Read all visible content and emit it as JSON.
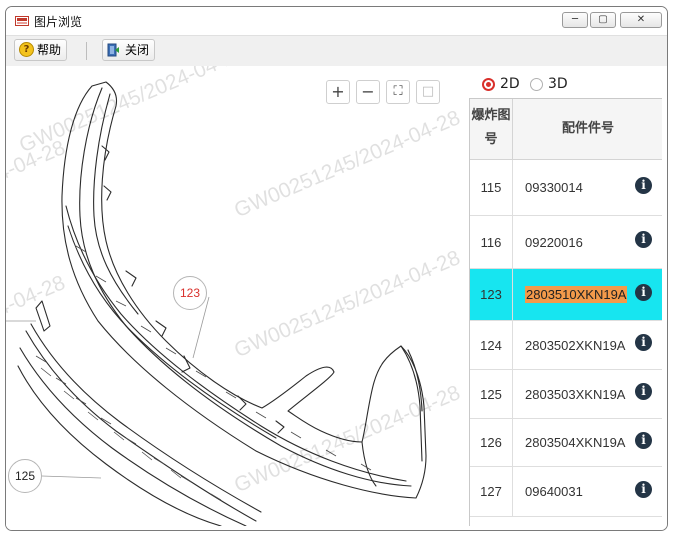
{
  "window": {
    "title": "图片浏览",
    "controls": {
      "minimize": "─",
      "maximize": "▢",
      "close": "✕"
    }
  },
  "toolbar": {
    "help_label": "帮助",
    "close_label": "关闭"
  },
  "viewer": {
    "watermark": "GW00251245/2024-04-28",
    "zoom_controls": {
      "zoom_in": "+",
      "zoom_out": "−",
      "fit": "⛶",
      "page": "□"
    },
    "callouts": [
      {
        "label": "123",
        "highlighted": true
      },
      {
        "label": "125",
        "highlighted": false
      }
    ]
  },
  "view_mode": {
    "options": [
      "2D",
      "3D"
    ],
    "selected": "2D"
  },
  "table": {
    "headers": [
      "爆炸图号",
      "配件件号"
    ],
    "header_no_lines": [
      "爆炸图",
      "号"
    ],
    "rows": [
      {
        "no": "115",
        "part": "09330014",
        "selected": false
      },
      {
        "no": "116",
        "part": "09220016",
        "selected": false
      },
      {
        "no": "123",
        "part": "2803510XKN19A",
        "selected": true
      },
      {
        "no": "124",
        "part": "2803502XKN19A",
        "selected": false
      },
      {
        "no": "125",
        "part": "2803503XKN19A",
        "selected": false
      },
      {
        "no": "126",
        "part": "2803504XKN19A",
        "selected": false
      },
      {
        "no": "127",
        "part": "09640031",
        "selected": false
      }
    ],
    "info_icon": "i"
  },
  "colors": {
    "selected_row": "#17e5f0",
    "part_highlight": "#f39a4a",
    "radio_accent": "#d9302b",
    "info_icon": "#243546"
  }
}
